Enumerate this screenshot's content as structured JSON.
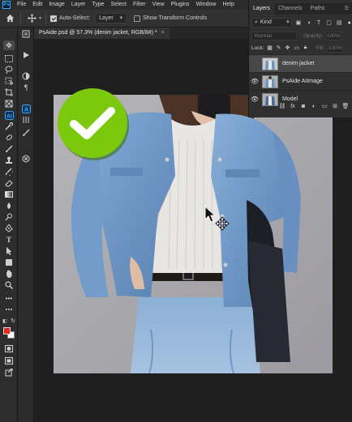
{
  "menubar": {
    "logo": "Ps",
    "items": [
      "File",
      "Edit",
      "Image",
      "Layer",
      "Type",
      "Select",
      "Filter",
      "View",
      "Plugins",
      "Window",
      "Help"
    ]
  },
  "options": {
    "auto_select_label": "Auto-Select:",
    "auto_select_checked": true,
    "auto_select_target": "Layer",
    "show_transform_label": "Show Transform Controls",
    "show_transform_checked": false
  },
  "document": {
    "tab_title": "PsAide.psd @ 57.3% (denim jacket, RGB/8#) *",
    "close_glyph": "×"
  },
  "layers_panel": {
    "tabs": [
      "Layers",
      "Channels",
      "Paths"
    ],
    "active_tab": "Layers",
    "filter_kind": "Kind",
    "blend_mode": "Normal",
    "opacity_label": "Opacity:",
    "opacity_value": "100%",
    "lock_label": "Lock:",
    "fill_label": "Fill:",
    "fill_value": "100%",
    "layers": [
      {
        "name": "denim jacket",
        "visible": false,
        "selected": true
      },
      {
        "name": "PsAide AIImage",
        "visible": true,
        "selected": false
      },
      {
        "name": "Model",
        "visible": true,
        "selected": false
      }
    ]
  },
  "overlay": {
    "check_badge_color": "#7cc80c"
  },
  "colors": {
    "foreground": "#e8271c",
    "background": "#ffffff",
    "accent": "#31a8ff"
  }
}
